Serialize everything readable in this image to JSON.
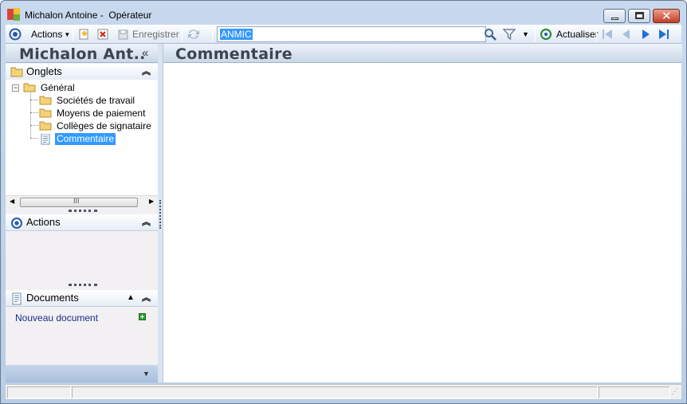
{
  "window": {
    "title": "Michalon Antoine -  Opérateur"
  },
  "toolbar": {
    "actions_label": "Actions",
    "save_label": "Enregistrer",
    "search_value": "ANMIC",
    "refresh_label": "Actualiser"
  },
  "left_panel": {
    "user_name": "Michalon Ant..",
    "collapse_glyph": "«",
    "tabs_section": {
      "title": "Onglets",
      "tree": {
        "root": "Général",
        "children": [
          "Sociétés de travail",
          "Moyens de paiement",
          "Collèges de signataire",
          "Commentaire"
        ],
        "selected": "Commentaire"
      },
      "scrollbar_grip": "III"
    },
    "actions_section": {
      "title": "Actions"
    },
    "documents_section": {
      "title": "Documents",
      "new_document_link": "Nouveau document"
    }
  },
  "main": {
    "title": "Commentaire"
  },
  "colors": {
    "selection": "#3399ff",
    "chrome": "#c8d9ee",
    "header_text": "#3b4450",
    "link": "#1c2c8c"
  }
}
